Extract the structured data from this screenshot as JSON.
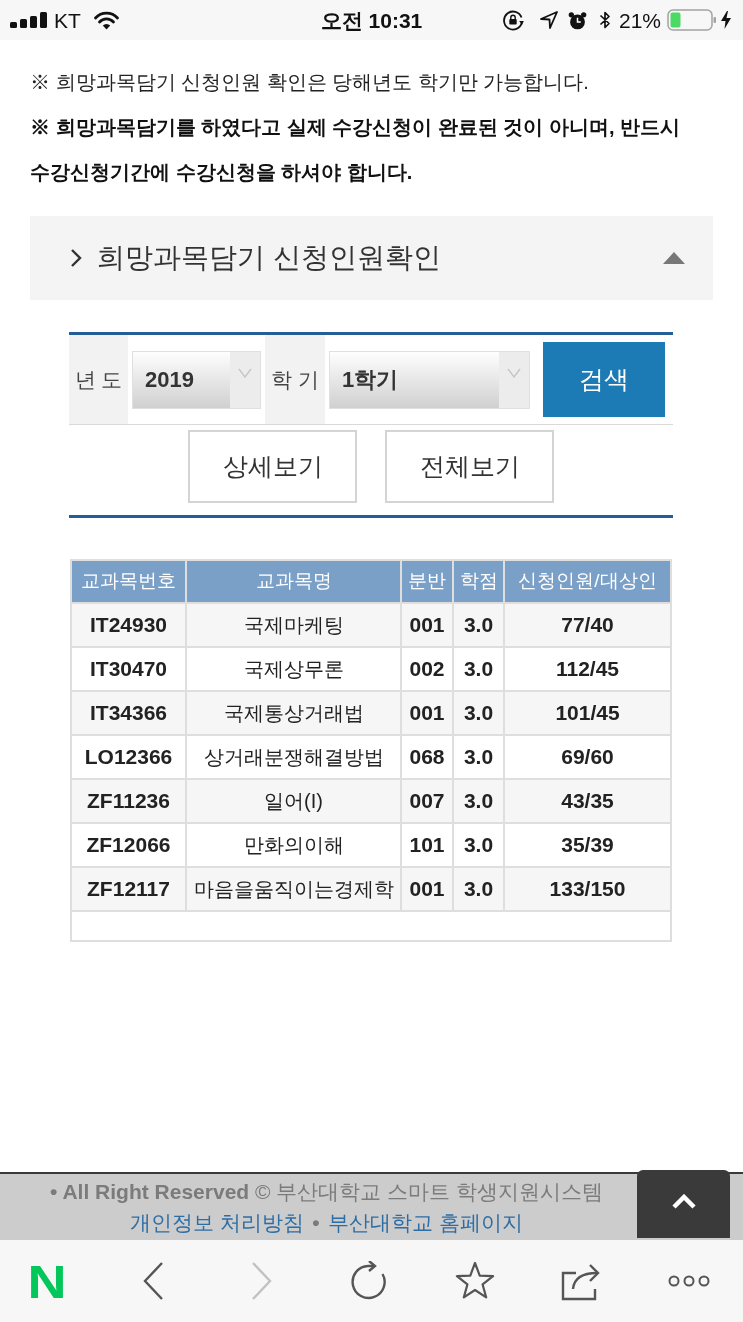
{
  "status_bar": {
    "carrier": "KT",
    "time": "오전 10:31",
    "battery": "21%"
  },
  "notices": [
    {
      "kind": "info",
      "text": "※ 희망과목담기 신청인원 확인은 당해년도 학기만 가능합니다."
    },
    {
      "kind": "warning",
      "text": "※ 희망과목담기를 하였다고 실제 수강신청이 완료된 것이 아니며, 반드시 수강신청기간에 수강신청을 하셔야 합니다."
    }
  ],
  "accordion": {
    "title": "희망과목담기 신청인원확인",
    "expanded": true
  },
  "search_form": {
    "fields": [
      {
        "label": "년 도",
        "value": "2019"
      },
      {
        "label": "학 기",
        "value": "1학기"
      }
    ],
    "search_button": "검색",
    "view_buttons": [
      "상세보기",
      "전체보기"
    ]
  },
  "table": {
    "columns": [
      "교과목번호",
      "교과목명",
      "분반",
      "학점",
      "신청인원/대상인"
    ],
    "rows": [
      [
        "IT24930",
        "국제마케팅",
        "001",
        "3.0",
        "77/40"
      ],
      [
        "IT30470",
        "국제상무론",
        "002",
        "3.0",
        "112/45"
      ],
      [
        "IT34366",
        "국제통상거래법",
        "001",
        "3.0",
        "101/45"
      ],
      [
        "LO12366",
        "상거래분쟁해결방법",
        "068",
        "3.0",
        "69/60"
      ],
      [
        "ZF11236",
        "일어(I)",
        "007",
        "3.0",
        "43/35"
      ],
      [
        "ZF12066",
        "만화의이해",
        "101",
        "3.0",
        "35/39"
      ],
      [
        "ZF12117",
        "마음을움직이는경제학",
        "001",
        "3.0",
        "133/150"
      ]
    ]
  },
  "footer": {
    "copyright": "**• All Right Reserved** © 부산대학교 스마트 학생지원시스템",
    "links": [
      "개인정보 처리방침",
      "부산대학교 홈페이지"
    ],
    "separator": "•"
  },
  "browser_toolbar": {
    "logo": "N",
    "buttons": [
      {
        "kind": "back",
        "disabled": false
      },
      {
        "kind": "forward",
        "disabled": true
      },
      {
        "kind": "reload",
        "disabled": false
      },
      {
        "kind": "bookmark",
        "disabled": false
      },
      {
        "kind": "share",
        "disabled": false
      },
      {
        "kind": "more",
        "disabled": false
      }
    ]
  }
}
